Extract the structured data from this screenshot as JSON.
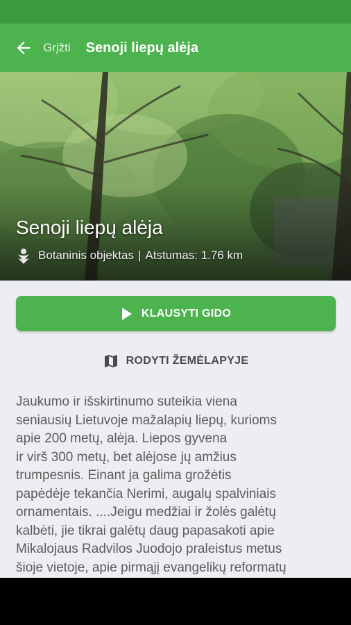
{
  "toolbar": {
    "back_icon": "arrow-left-icon",
    "back_label": "Grįžti",
    "title": "Senoji liepų alėja",
    "color": "#4db34f",
    "status_color": "#3a9b3f"
  },
  "hero": {
    "title": "Senoji liepų alėja",
    "category_icon": "flower-icon",
    "category": "Botaninis objektas",
    "separator": "|",
    "distance": "Atstumas: 1.76 km"
  },
  "actions": {
    "listen_icon": "play-icon",
    "listen_label": "KLAUSYTI GIDO",
    "map_icon": "map-icon",
    "map_label": "RODYTI ŽEMĖLAPYJE"
  },
  "description": "Jaukumo ir išskirtinumo suteikia viena\nseniausių Lietuvoje mažalapių liepų, kurioms\napie 200 metų,  alėja. Liepos gyvena\nir virš 300 metų, bet alėjose jų amžius\ntrumpesnis. Einant ja galima grožėtis\npapėdėje tekančia Nerimi, augalų spalviniais\nornamentais.  ....Jeigu medžiai ir žolės galėtų\nkalbėti, jie tikrai galėtų daug papasakoti apie\nMikalojaus Radvilos Juodojo praleistus metus\nšioje vietoje, apie pirmąjį evangelikų reformatų"
}
